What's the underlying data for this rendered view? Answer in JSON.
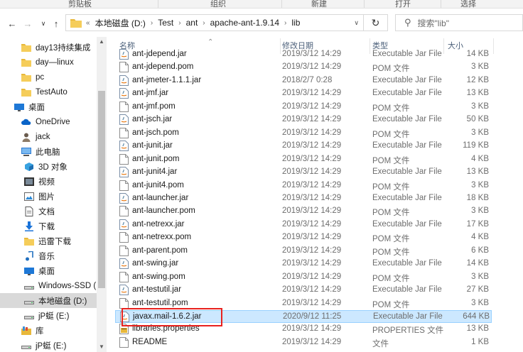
{
  "ribbon": {
    "groups": [
      "剪贴板",
      "组织",
      "新建",
      "打开",
      "选择"
    ]
  },
  "nav": {
    "back_icon": "back-arrow-icon",
    "forward_icon": "forward-arrow-icon",
    "recent_icon": "chevron-down-icon",
    "up_icon": "up-arrow-icon"
  },
  "address": {
    "overflow": "«",
    "crumbs": [
      "本地磁盘 (D:)",
      "Test",
      "ant",
      "apache-ant-1.9.14",
      "lib"
    ]
  },
  "search": {
    "placeholder": "搜索\"lib\""
  },
  "navpane": {
    "items": [
      {
        "label": "day13持续集成",
        "icon": "folder-icon",
        "indent": 1
      },
      {
        "label": "day—linux",
        "icon": "folder-icon",
        "indent": 1
      },
      {
        "label": "pc",
        "icon": "folder-icon",
        "indent": 1
      },
      {
        "label": "TestAuto",
        "icon": "folder-icon",
        "indent": 1
      },
      {
        "label": "桌面",
        "icon": "desktop-icon",
        "indent": 0
      },
      {
        "label": "OneDrive",
        "icon": "cloud-icon",
        "indent": 1
      },
      {
        "label": "jack",
        "icon": "user-icon",
        "indent": 1
      },
      {
        "label": "此电脑",
        "icon": "computer-icon",
        "indent": 1
      },
      {
        "label": "3D 对象",
        "icon": "cube-icon",
        "indent": 2
      },
      {
        "label": "视频",
        "icon": "video-icon",
        "indent": 2
      },
      {
        "label": "图片",
        "icon": "picture-icon",
        "indent": 2
      },
      {
        "label": "文档",
        "icon": "document-icon",
        "indent": 2
      },
      {
        "label": "下载",
        "icon": "download-icon",
        "indent": 2
      },
      {
        "label": "迅雷下载",
        "icon": "folder-icon",
        "indent": 2
      },
      {
        "label": "音乐",
        "icon": "music-icon",
        "indent": 2
      },
      {
        "label": "桌面",
        "icon": "desktop-icon",
        "indent": 2
      },
      {
        "label": "Windows-SSD (",
        "icon": "drive-icon",
        "indent": 2
      },
      {
        "label": "本地磁盘 (D:)",
        "icon": "drive-icon",
        "indent": 2,
        "selected": true
      },
      {
        "label": "jP蜓 (E:)",
        "icon": "drive-icon",
        "indent": 2
      },
      {
        "label": "库",
        "icon": "library-icon",
        "indent": 1
      },
      {
        "label": "jP蜓 (E:)",
        "icon": "drive-icon",
        "indent": 1
      }
    ]
  },
  "columns": {
    "name": "名称",
    "date": "修改日期",
    "type": "类型",
    "size": "大小"
  },
  "files": [
    {
      "name": "ant-jdepend.jar",
      "date": "2019/3/12 14:29",
      "type": "Executable Jar File",
      "size": "14 KB",
      "icon": "jar-icon"
    },
    {
      "name": "ant-jdepend.pom",
      "date": "2019/3/12 14:29",
      "type": "POM 文件",
      "size": "3 KB",
      "icon": "file-icon"
    },
    {
      "name": "ant-jmeter-1.1.1.jar",
      "date": "2018/2/7 0:28",
      "type": "Executable Jar File",
      "size": "12 KB",
      "icon": "jar-icon"
    },
    {
      "name": "ant-jmf.jar",
      "date": "2019/3/12 14:29",
      "type": "Executable Jar File",
      "size": "13 KB",
      "icon": "jar-icon"
    },
    {
      "name": "ant-jmf.pom",
      "date": "2019/3/12 14:29",
      "type": "POM 文件",
      "size": "3 KB",
      "icon": "file-icon"
    },
    {
      "name": "ant-jsch.jar",
      "date": "2019/3/12 14:29",
      "type": "Executable Jar File",
      "size": "50 KB",
      "icon": "jar-icon"
    },
    {
      "name": "ant-jsch.pom",
      "date": "2019/3/12 14:29",
      "type": "POM 文件",
      "size": "3 KB",
      "icon": "file-icon"
    },
    {
      "name": "ant-junit.jar",
      "date": "2019/3/12 14:29",
      "type": "Executable Jar File",
      "size": "119 KB",
      "icon": "jar-icon"
    },
    {
      "name": "ant-junit.pom",
      "date": "2019/3/12 14:29",
      "type": "POM 文件",
      "size": "4 KB",
      "icon": "file-icon"
    },
    {
      "name": "ant-junit4.jar",
      "date": "2019/3/12 14:29",
      "type": "Executable Jar File",
      "size": "13 KB",
      "icon": "jar-icon"
    },
    {
      "name": "ant-junit4.pom",
      "date": "2019/3/12 14:29",
      "type": "POM 文件",
      "size": "3 KB",
      "icon": "file-icon"
    },
    {
      "name": "ant-launcher.jar",
      "date": "2019/3/12 14:29",
      "type": "Executable Jar File",
      "size": "18 KB",
      "icon": "jar-icon"
    },
    {
      "name": "ant-launcher.pom",
      "date": "2019/3/12 14:29",
      "type": "POM 文件",
      "size": "3 KB",
      "icon": "file-icon"
    },
    {
      "name": "ant-netrexx.jar",
      "date": "2019/3/12 14:29",
      "type": "Executable Jar File",
      "size": "17 KB",
      "icon": "jar-icon"
    },
    {
      "name": "ant-netrexx.pom",
      "date": "2019/3/12 14:29",
      "type": "POM 文件",
      "size": "4 KB",
      "icon": "file-icon"
    },
    {
      "name": "ant-parent.pom",
      "date": "2019/3/12 14:29",
      "type": "POM 文件",
      "size": "6 KB",
      "icon": "file-icon"
    },
    {
      "name": "ant-swing.jar",
      "date": "2019/3/12 14:29",
      "type": "Executable Jar File",
      "size": "14 KB",
      "icon": "jar-icon"
    },
    {
      "name": "ant-swing.pom",
      "date": "2019/3/12 14:29",
      "type": "POM 文件",
      "size": "3 KB",
      "icon": "file-icon"
    },
    {
      "name": "ant-testutil.jar",
      "date": "2019/3/12 14:29",
      "type": "Executable Jar File",
      "size": "27 KB",
      "icon": "jar-icon"
    },
    {
      "name": "ant-testutil.pom",
      "date": "2019/3/12 14:29",
      "type": "POM 文件",
      "size": "3 KB",
      "icon": "file-icon"
    },
    {
      "name": "javax.mail-1.6.2.jar",
      "date": "2020/9/12 11:25",
      "type": "Executable Jar File",
      "size": "644 KB",
      "icon": "jar-icon",
      "selected": true
    },
    {
      "name": "libraries.properties",
      "date": "2019/3/12 14:29",
      "type": "PROPERTIES 文件",
      "size": "13 KB",
      "icon": "properties-icon"
    },
    {
      "name": "README",
      "date": "2019/3/12 14:29",
      "type": "文件",
      "size": "1 KB",
      "icon": "file-icon"
    }
  ],
  "colors": {
    "selection_bg": "#cce8ff",
    "selection_border": "#99d1ff",
    "highlight_annotation": "#e8221f",
    "nav_selected": "#d9d9d9",
    "folder_yellow": "#e8b83a"
  }
}
